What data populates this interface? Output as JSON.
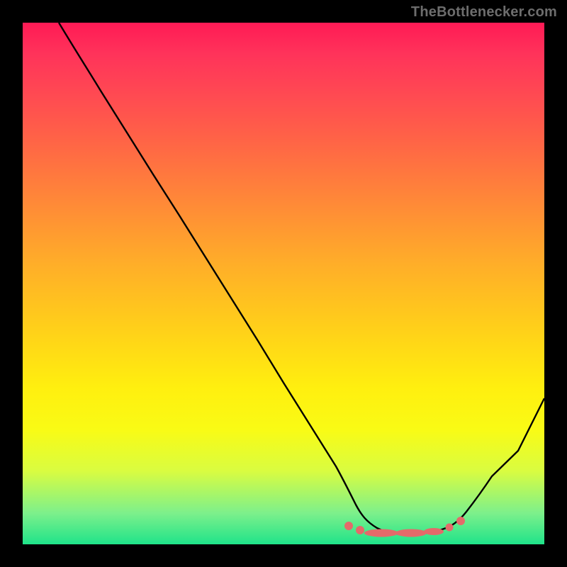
{
  "watermark": "TheBottlenecker.com",
  "colors": {
    "top": "#ff1a55",
    "mid": "#ffd916",
    "bottom": "#1fe38a",
    "curve": "#000000",
    "marker": "#e46a6a",
    "frame": "#000000"
  },
  "chart_data": {
    "type": "line",
    "title": "",
    "xlabel": "",
    "ylabel": "",
    "xlim": [
      0,
      100
    ],
    "ylim": [
      0,
      100
    ],
    "grid": false,
    "legend": false,
    "series": [
      {
        "name": "bottleneck-curve",
        "x": [
          7,
          10,
          15,
          20,
          25,
          30,
          35,
          40,
          45,
          50,
          55,
          60,
          62,
          65,
          68,
          71,
          74,
          77,
          80,
          83,
          86,
          90,
          95,
          100
        ],
        "values": [
          100,
          95,
          87,
          79,
          71,
          63,
          55,
          47,
          39,
          31,
          23,
          15,
          12,
          8,
          5,
          3,
          2,
          2,
          2,
          3,
          5,
          10,
          18,
          28
        ]
      }
    ],
    "markers": {
      "name": "highlight-band",
      "x": [
        62,
        65,
        67,
        69,
        71,
        73,
        75,
        77,
        79,
        81,
        83,
        84
      ],
      "values": [
        3,
        3,
        3,
        3,
        3,
        3,
        3,
        3,
        3,
        3,
        4,
        5
      ]
    },
    "background_heatmap": "vertical-gradient red→yellow→green (top = worst, bottom = optimal)"
  }
}
